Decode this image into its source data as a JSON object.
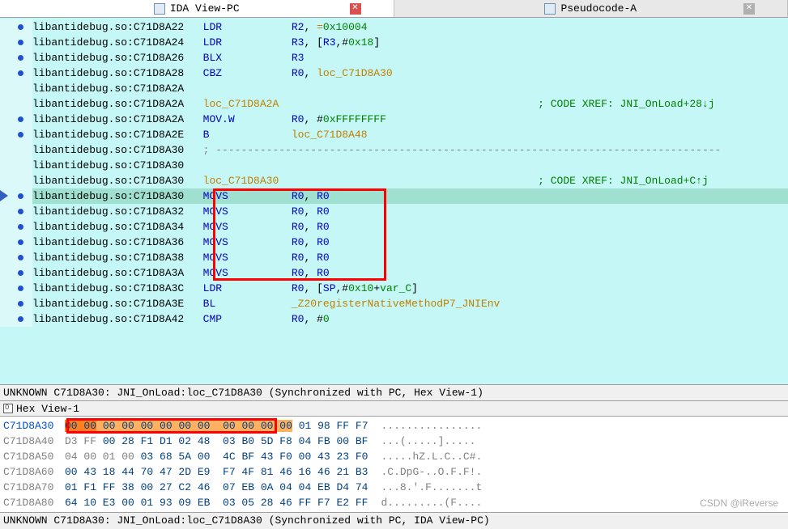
{
  "tabs": [
    {
      "title": "IDA View-PC",
      "active": true
    },
    {
      "title": "Pseudocode-A",
      "active": false
    }
  ],
  "disasm": [
    {
      "dot": true,
      "addr": "libantidebug.so:C71D8A22",
      "mnem": "LDR",
      "ops": [
        [
          "reg",
          "R2"
        ],
        [
          "txt",
          ", "
        ],
        [
          "lbl",
          "="
        ],
        [
          "num",
          "0x10004"
        ]
      ]
    },
    {
      "dot": true,
      "addr": "libantidebug.so:C71D8A24",
      "mnem": "LDR",
      "ops": [
        [
          "reg",
          "R3"
        ],
        [
          "txt",
          ", ["
        ],
        [
          "reg",
          "R3"
        ],
        [
          "txt",
          ",#"
        ],
        [
          "num",
          "0x18"
        ],
        [
          "txt",
          "]"
        ]
      ]
    },
    {
      "dot": true,
      "addr": "libantidebug.so:C71D8A26",
      "mnem": "BLX",
      "ops": [
        [
          "reg",
          "R3"
        ]
      ]
    },
    {
      "dot": true,
      "addr": "libantidebug.so:C71D8A28",
      "mnem": "CBZ",
      "ops": [
        [
          "reg",
          "R0"
        ],
        [
          "txt",
          ", "
        ],
        [
          "lbl",
          "loc_C71D8A30"
        ]
      ]
    },
    {
      "dot": false,
      "addr": "libantidebug.so:C71D8A2A",
      "mnem": "",
      "ops": []
    },
    {
      "dot": false,
      "addr": "libantidebug.so:C71D8A2A",
      "mnem": "",
      "label": "loc_C71D8A2A",
      "xref": "; CODE XREF: JNI_OnLoad+28↓j"
    },
    {
      "dot": true,
      "addr": "libantidebug.so:C71D8A2A",
      "mnem": "MOV.W",
      "ops": [
        [
          "reg",
          "R0"
        ],
        [
          "txt",
          ", #"
        ],
        [
          "num",
          "0xFFFFFFFF"
        ]
      ]
    },
    {
      "dot": true,
      "addr": "libantidebug.so:C71D8A2E",
      "mnem": "B",
      "ops": [
        [
          "lbl",
          "loc_C71D8A48"
        ]
      ]
    },
    {
      "dot": false,
      "addr": "libantidebug.so:C71D8A30",
      "mnem": "",
      "dashes": true
    },
    {
      "dot": false,
      "addr": "libantidebug.so:C71D8A30",
      "mnem": "",
      "ops": []
    },
    {
      "dot": false,
      "addr": "libantidebug.so:C71D8A30",
      "mnem": "",
      "label": "loc_C71D8A30",
      "xref": "; CODE XREF: JNI_OnLoad+C↑j"
    },
    {
      "dot": true,
      "arrow": true,
      "hl": true,
      "addr": "libantidebug.so:C71D8A30",
      "mnem": "MOVS",
      "ops": [
        [
          "reg",
          "R0"
        ],
        [
          "txt",
          ", "
        ],
        [
          "reg",
          "R0"
        ]
      ]
    },
    {
      "dot": true,
      "addr": "libantidebug.so:C71D8A32",
      "mnem": "MOVS",
      "ops": [
        [
          "reg",
          "R0"
        ],
        [
          "txt",
          ", "
        ],
        [
          "reg",
          "R0"
        ]
      ]
    },
    {
      "dot": true,
      "addr": "libantidebug.so:C71D8A34",
      "mnem": "MOVS",
      "ops": [
        [
          "reg",
          "R0"
        ],
        [
          "txt",
          ", "
        ],
        [
          "reg",
          "R0"
        ]
      ]
    },
    {
      "dot": true,
      "addr": "libantidebug.so:C71D8A36",
      "mnem": "MOVS",
      "ops": [
        [
          "reg",
          "R0"
        ],
        [
          "txt",
          ", "
        ],
        [
          "reg",
          "R0"
        ]
      ]
    },
    {
      "dot": true,
      "addr": "libantidebug.so:C71D8A38",
      "mnem": "MOVS",
      "ops": [
        [
          "reg",
          "R0"
        ],
        [
          "txt",
          ", "
        ],
        [
          "reg",
          "R0"
        ]
      ]
    },
    {
      "dot": true,
      "addr": "libantidebug.so:C71D8A3A",
      "mnem": "MOVS",
      "ops": [
        [
          "reg",
          "R0"
        ],
        [
          "txt",
          ", "
        ],
        [
          "reg",
          "R0"
        ]
      ]
    },
    {
      "dot": true,
      "addr": "libantidebug.so:C71D8A3C",
      "mnem": "LDR",
      "ops": [
        [
          "reg",
          "R0"
        ],
        [
          "txt",
          ", ["
        ],
        [
          "reg",
          "SP"
        ],
        [
          "txt",
          ",#"
        ],
        [
          "num",
          "0x10"
        ],
        [
          "txt",
          "+"
        ],
        [
          "var",
          "var_C"
        ],
        [
          "txt",
          "]"
        ]
      ]
    },
    {
      "dot": true,
      "addr": "libantidebug.so:C71D8A3E",
      "mnem": "BL",
      "ops": [
        [
          "lbl",
          "_Z20registerNativeMethodP7_JNIEnv"
        ]
      ]
    },
    {
      "dot": true,
      "addr": "libantidebug.so:C71D8A42",
      "mnem": "CMP",
      "ops": [
        [
          "reg",
          "R0"
        ],
        [
          "txt",
          ", #"
        ],
        [
          "num",
          "0"
        ]
      ]
    }
  ],
  "status_top": "UNKNOWN C71D8A30: JNI_OnLoad:loc_C71D8A30 (Synchronized with PC, Hex View-1)",
  "hex_tab": "Hex View-1",
  "hex_lines": [
    {
      "addr": "C71D8A30",
      "active": true,
      "bytes": [
        [
          "hlsel",
          "00 00"
        ],
        [
          "hl",
          " "
        ],
        [
          "hl",
          "00 00 00 00 00 00"
        ],
        [
          "hl",
          "  "
        ],
        [
          "hl",
          "00 00 00 00"
        ],
        [
          "txt",
          " "
        ],
        [
          "txt",
          "01 98 FF F7"
        ]
      ],
      "ascii": "................",
      "boxed": true
    },
    {
      "addr": "C71D8A40",
      "bytes": [
        [
          "gray",
          "D3 FF "
        ],
        [
          "txt",
          "00 28 F1 D1 02 48  03 B0 5D F8 04 FB 00 BF"
        ]
      ],
      "ascii": "...(.....]....."
    },
    {
      "addr": "C71D8A50",
      "bytes": [
        [
          "gray",
          "04 00 01 00 "
        ],
        [
          "txt",
          "03 68 5A 00  4C BF 43 F0 00 43 23 F0"
        ]
      ],
      "ascii": ".....hZ.L.C..C#."
    },
    {
      "addr": "C71D8A60",
      "bytes": [
        [
          "txt",
          "00 43 18 44 70 47 2D E9  F7 4F 81 46 16 46 21 B3"
        ]
      ],
      "ascii": ".C.DpG-..O.F.F!."
    },
    {
      "addr": "C71D8A70",
      "bytes": [
        [
          "txt",
          "01 F1 FF 38 00 27 C2 46  07 EB 0A 04 04 EB D4 74"
        ]
      ],
      "ascii": "...8.'.F.......t"
    },
    {
      "addr": "C71D8A80",
      "bytes": [
        [
          "txt",
          "64 10 E3 00 01 93 09 EB  03 05 28 46 FF F7 E2 FF"
        ]
      ],
      "ascii": "d.........(F...."
    }
  ],
  "status_bottom": "UNKNOWN C71D8A30: JNI_OnLoad:loc_C71D8A30 (Synchronized with PC, IDA View-PC)",
  "watermark": "CSDN @iReverse"
}
